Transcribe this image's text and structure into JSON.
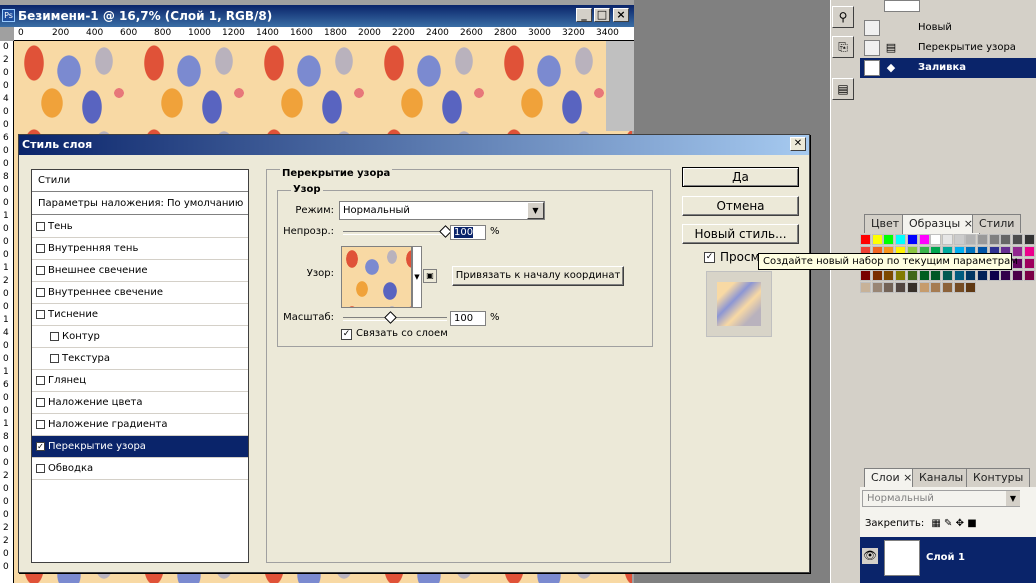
{
  "document": {
    "title": "Безимени-1 @ 16,7% (Слой 1, RGB/8)",
    "ruler_h": [
      "0",
      "200",
      "400",
      "600",
      "800",
      "1000",
      "1200",
      "1400",
      "1600",
      "1800",
      "2000",
      "2200",
      "2400",
      "2600",
      "2800",
      "3000",
      "3200",
      "3400"
    ],
    "ruler_v": [
      "0",
      "2",
      "0",
      "0",
      "4",
      "0",
      "0",
      "6",
      "0",
      "0",
      "8",
      "0",
      "0",
      "1",
      "0",
      "0",
      "0",
      "1",
      "2",
      "0",
      "0",
      "1",
      "4",
      "0",
      "0",
      "1",
      "6",
      "0",
      "0",
      "1",
      "8",
      "0",
      "0",
      "2",
      "0",
      "0",
      "0",
      "2",
      "2",
      "0",
      "0"
    ]
  },
  "history": {
    "items": [
      {
        "label": "Новый",
        "icon": "new-document-icon"
      },
      {
        "label": "Перекрытие узора",
        "icon": "history-step-icon"
      },
      {
        "label": "Заливка",
        "icon": "fill-bucket-icon"
      }
    ]
  },
  "swatches_panel": {
    "tabs": [
      {
        "label": "Цвет",
        "close": ""
      },
      {
        "label": "Образцы",
        "close": "×"
      },
      {
        "label": "Стили",
        "close": ""
      }
    ],
    "colors": [
      "#ff0000",
      "#ffff00",
      "#00ff00",
      "#00ffff",
      "#0000ff",
      "#ff00ff",
      "#ffffff",
      "#e6e6e6",
      "#cccccc",
      "#b3b3b3",
      "#999999",
      "#808080",
      "#666666",
      "#4d4d4d",
      "#333333",
      "#ef4136",
      "#f26522",
      "#f7941d",
      "#fff200",
      "#8dc63f",
      "#39b54a",
      "#00a651",
      "#00a99d",
      "#00aeef",
      "#0072bc",
      "#0054a6",
      "#2e3192",
      "#662d91",
      "#92278f",
      "#ec008c",
      "#9e0b0f",
      "#a0410d",
      "#a3620a",
      "#aba000",
      "#598527",
      "#1a7b30",
      "#007236",
      "#00746b",
      "#0076a3",
      "#004b80",
      "#003471",
      "#1b1464",
      "#440e62",
      "#630460",
      "#9e005d",
      "#790000",
      "#7b2e00",
      "#7d4900",
      "#827b00",
      "#406618",
      "#005e20",
      "#005826",
      "#005952",
      "#005b7f",
      "#003663",
      "#002157",
      "#0d004c",
      "#32004b",
      "#4b0049",
      "#7b0046",
      "#c7b299",
      "#998675",
      "#736357",
      "#534741",
      "#37302a",
      "#c69c6d",
      "#a67c52",
      "#8c6239",
      "#754c24",
      "#603913"
    ]
  },
  "dialog": {
    "title": "Стиль слоя",
    "styles_header": "Стили",
    "blending": "Параметры наложения: По умолчанию",
    "effects": [
      {
        "label": "Тень",
        "checked": false,
        "indent": false,
        "selected": false
      },
      {
        "label": "Внутренняя тень",
        "checked": false,
        "indent": false,
        "selected": false
      },
      {
        "label": "Внешнее свечение",
        "checked": false,
        "indent": false,
        "selected": false
      },
      {
        "label": "Внутреннее свечение",
        "checked": false,
        "indent": false,
        "selected": false
      },
      {
        "label": "Тиснение",
        "checked": false,
        "indent": false,
        "selected": false
      },
      {
        "label": "Контур",
        "checked": false,
        "indent": true,
        "selected": false
      },
      {
        "label": "Текстура",
        "checked": false,
        "indent": true,
        "selected": false
      },
      {
        "label": "Глянец",
        "checked": false,
        "indent": false,
        "selected": false
      },
      {
        "label": "Наложение цвета",
        "checked": false,
        "indent": false,
        "selected": false
      },
      {
        "label": "Наложение градиента",
        "checked": false,
        "indent": false,
        "selected": false
      },
      {
        "label": "Перекрытие узора",
        "checked": true,
        "indent": false,
        "selected": true
      },
      {
        "label": "Обводка",
        "checked": false,
        "indent": false,
        "selected": false
      }
    ],
    "section_title": "Перекрытие узора",
    "group_title": "Узор",
    "mode_label": "Режим:",
    "mode_value": "Нормальный",
    "opacity_label": "Непрозр.:",
    "opacity_value": "100",
    "opacity_unit": "%",
    "opacity_level": 1.0,
    "pattern_label": "Узор:",
    "snap_button": "Привязать к началу координат",
    "scale_label": "Масштаб:",
    "scale_value": "100",
    "scale_unit": "%",
    "scale_level": 0.45,
    "link_label": "Связать со слоем",
    "link_checked": true,
    "ok": "Да",
    "cancel": "Отмена",
    "new_style": "Новый стиль...",
    "preview_label": "Просм",
    "preview_checked": true,
    "tooltip": "Создайте новый набор по текущим параметрам"
  },
  "layers_panel": {
    "tabs": [
      {
        "label": "Слои",
        "close": "×"
      },
      {
        "label": "Каналы",
        "close": ""
      },
      {
        "label": "Контуры",
        "close": ""
      }
    ],
    "blend_mode": "Нормальный",
    "lock_label": "Закрепить:",
    "layer_name": "Слой 1"
  }
}
